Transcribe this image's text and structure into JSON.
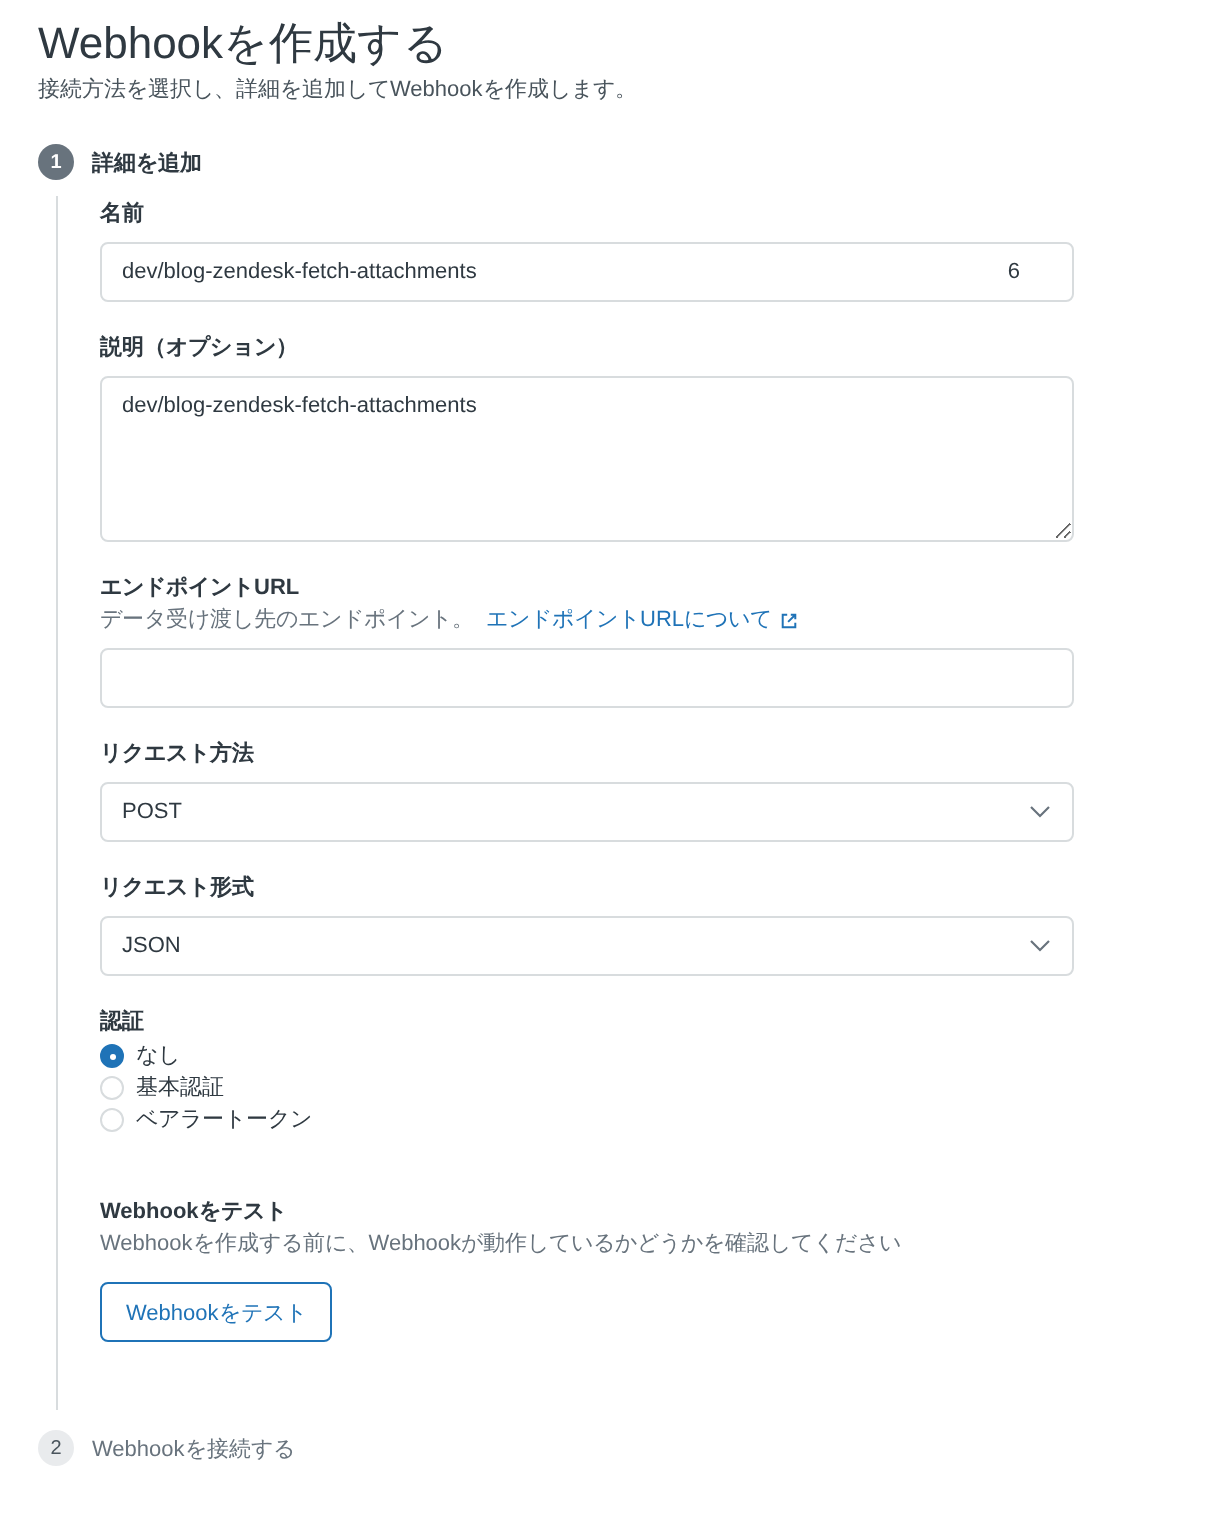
{
  "page": {
    "title": "Webhookを作成する",
    "subtitle": "接続方法を選択し、詳細を追加してWebhookを作成します。"
  },
  "steps": [
    {
      "number": "1",
      "label": "詳細を追加",
      "current": true,
      "fields": [
        {
          "kind": "text",
          "label": "名前",
          "value": "dev/blog-zendesk-fetch-attachments",
          "counter": "6"
        },
        {
          "kind": "textarea",
          "label": "説明（オプション）",
          "value": "dev/blog-zendesk-fetch-attachments"
        },
        {
          "kind": "text",
          "label": "エンドポイントURL",
          "hint": "データ受け渡し先のエンドポイント。",
          "link": "エンドポイントURLについて"
        },
        {
          "kind": "select",
          "label": "リクエスト方法",
          "value": "POST"
        },
        {
          "kind": "select",
          "label": "リクエスト形式",
          "value": "JSON"
        },
        {
          "kind": "radio",
          "label": "認証",
          "options": [
            {
              "label": "なし",
              "selected": true
            },
            {
              "label": "基本認証",
              "selected": false
            },
            {
              "label": "ベアラートークン",
              "selected": false
            }
          ]
        },
        {
          "kind": "test",
          "label": "Webhookをテスト",
          "hint": "Webhookを作成する前に、Webhookが動作しているかどうかを確認してください",
          "button": "Webhookをテスト"
        }
      ]
    },
    {
      "number": "2",
      "label": "Webhookを接続する",
      "current": false
    }
  ]
}
